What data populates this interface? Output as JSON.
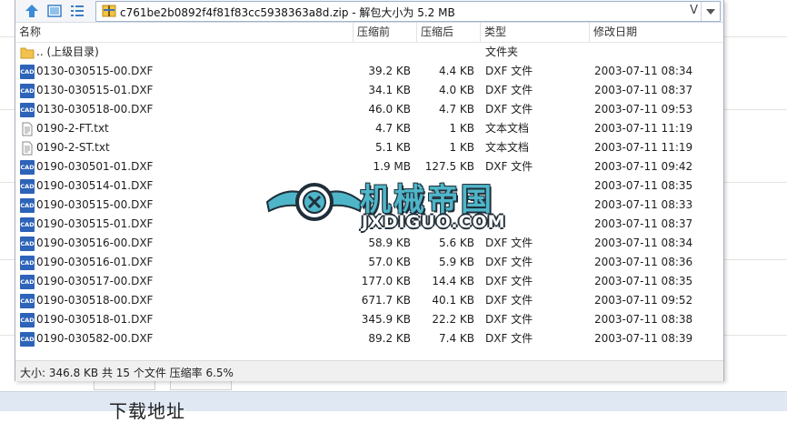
{
  "toolbar": {
    "path": "c761be2b0892f4f81f83cc5938363a8d.zip - 解包大小为 5.2 MB",
    "path_v_glyph": "V"
  },
  "columns": {
    "name": "名称",
    "size": "压缩前",
    "packed": "压缩后",
    "type": "类型",
    "date": "修改日期"
  },
  "rows": [
    {
      "icon": "folder-icon",
      "name": ".. (上级目录)",
      "size": "",
      "packed": "",
      "type": "文件夹",
      "date": ""
    },
    {
      "icon": "cad-file-icon",
      "name": "0130-030515-00.DXF",
      "size": "39.2 KB",
      "packed": "4.4 KB",
      "type": "DXF 文件",
      "date": "2003-07-11 08:34"
    },
    {
      "icon": "cad-file-icon",
      "name": "0130-030515-01.DXF",
      "size": "34.1 KB",
      "packed": "4.0 KB",
      "type": "DXF 文件",
      "date": "2003-07-11 08:37"
    },
    {
      "icon": "cad-file-icon",
      "name": "0130-030518-00.DXF",
      "size": "46.0 KB",
      "packed": "4.7 KB",
      "type": "DXF 文件",
      "date": "2003-07-11 09:53"
    },
    {
      "icon": "text-file-icon",
      "name": "0190-2-FT.txt",
      "size": "4.7 KB",
      "packed": "1 KB",
      "type": "文本文档",
      "date": "2003-07-11 11:19"
    },
    {
      "icon": "text-file-icon",
      "name": "0190-2-ST.txt",
      "size": "5.1 KB",
      "packed": "1 KB",
      "type": "文本文档",
      "date": "2003-07-11 11:19"
    },
    {
      "icon": "cad-file-icon",
      "name": "0190-030501-01.DXF",
      "size": "1.9 MB",
      "packed": "127.5 KB",
      "type": "DXF 文件",
      "date": "2003-07-11 09:42"
    },
    {
      "icon": "cad-file-icon",
      "name": "0190-030514-01.DXF",
      "size": "",
      "packed": "",
      "type": "",
      "date": "2003-07-11 08:35"
    },
    {
      "icon": "cad-file-icon",
      "name": "0190-030515-00.DXF",
      "size": "",
      "packed": "",
      "type": "",
      "date": "2003-07-11 08:33"
    },
    {
      "icon": "cad-file-icon",
      "name": "0190-030515-01.DXF",
      "size": "",
      "packed": "",
      "type": "",
      "date": "2003-07-11 08:37"
    },
    {
      "icon": "cad-file-icon",
      "name": "0190-030516-00.DXF",
      "size": "58.9 KB",
      "packed": "5.6 KB",
      "type": "DXF 文件",
      "date": "2003-07-11 08:34"
    },
    {
      "icon": "cad-file-icon",
      "name": "0190-030516-01.DXF",
      "size": "57.0 KB",
      "packed": "5.9 KB",
      "type": "DXF 文件",
      "date": "2003-07-11 08:36"
    },
    {
      "icon": "cad-file-icon",
      "name": "0190-030517-00.DXF",
      "size": "177.0 KB",
      "packed": "14.4 KB",
      "type": "DXF 文件",
      "date": "2003-07-11 08:35"
    },
    {
      "icon": "cad-file-icon",
      "name": "0190-030518-00.DXF",
      "size": "671.7 KB",
      "packed": "40.1 KB",
      "type": "DXF 文件",
      "date": "2003-07-11 09:52"
    },
    {
      "icon": "cad-file-icon",
      "name": "0190-030518-01.DXF",
      "size": "345.9 KB",
      "packed": "22.2 KB",
      "type": "DXF 文件",
      "date": "2003-07-11 08:38"
    },
    {
      "icon": "cad-file-icon",
      "name": "0190-030582-00.DXF",
      "size": "89.2 KB",
      "packed": "7.4 KB",
      "type": "DXF 文件",
      "date": "2003-07-11 08:39"
    }
  ],
  "icons": {
    "cad_label": "CAD"
  },
  "status": "大小: 346.8 KB 共 15 个文件 压缩率 6.5%",
  "watermark": {
    "cn": "机械帝国",
    "en": "JXDIGUO.COM"
  },
  "page": {
    "heading": "下载地址"
  },
  "colors": {
    "cad_icon": "#2d63b8",
    "folder_icon": "#f2c14e",
    "watermark": "#4fb6c9"
  }
}
